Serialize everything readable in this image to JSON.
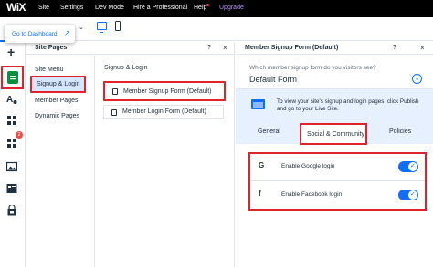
{
  "topbar": {
    "logo": "WiX",
    "menu": [
      "Site",
      "Settings",
      "Dev Mode",
      "Hire a Professional",
      "Help",
      "Upgrade"
    ]
  },
  "subbar": {
    "dashboard_tooltip": "Go to Dashboard",
    "devices": [
      "desktop-icon",
      "mobile-icon"
    ]
  },
  "rail": {
    "icons": [
      "add-icon",
      "pages-icon",
      "design-icon",
      "apps-icon",
      "app-market-icon",
      "media-icon",
      "blog-icon",
      "store-icon"
    ],
    "badge": "2"
  },
  "site_pages": {
    "title": "Site Pages",
    "help": "?",
    "close": "×",
    "nav": [
      "Site Menu",
      "Signup & Login",
      "Member Pages",
      "Dynamic Pages"
    ],
    "section_title": "Signup & Login",
    "forms": [
      "Member Signup Form (Default)",
      "Member Login Form (Default)"
    ]
  },
  "member_signup": {
    "title": "Member Signup Form (Default)",
    "help": "?",
    "close": "×",
    "question": "Which member signup form do you visitors see?",
    "selected_form": "Default Form",
    "info_line1": "To view your site's signup and login pages, click Publish",
    "info_line2": "and go to your Live Site.",
    "tabs": [
      "General",
      "Social & Community",
      "Policies"
    ],
    "social": [
      {
        "icon": "G",
        "label": "Enable Google login",
        "enabled": true
      },
      {
        "icon": "f",
        "label": "Enable Facebook login",
        "enabled": true
      }
    ]
  },
  "colors": {
    "accent": "#116dff",
    "highlight": "#e0222a",
    "topbar": "#000000",
    "pages_icon": "#0a8f3c"
  }
}
